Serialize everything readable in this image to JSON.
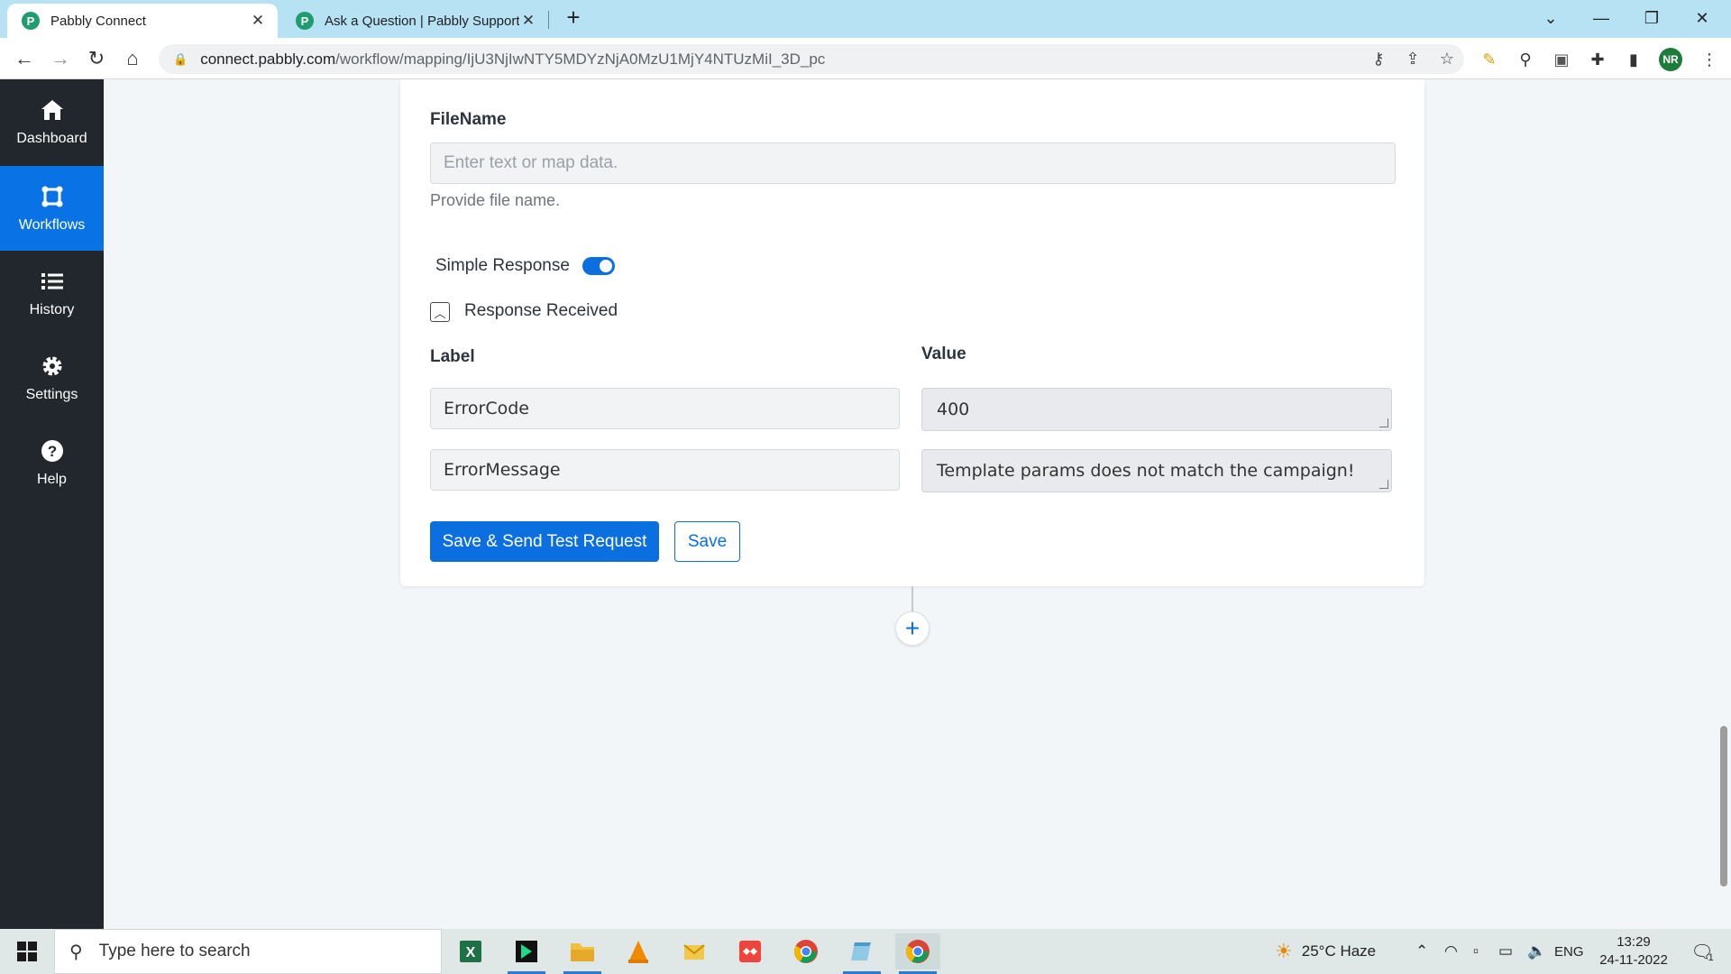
{
  "browser": {
    "tabs": [
      {
        "title": "Pabbly Connect",
        "active": true
      },
      {
        "title": "Ask a Question | Pabbly Support",
        "active": false
      }
    ],
    "url_host": "connect.pabbly.com",
    "url_path": "/workflow/mapping/IjU3NjIwNTY5MDYzNjA0MzU1MjY4NTUzMiI_3D_pc",
    "profile_initials": "NR"
  },
  "sidebar": {
    "items": [
      {
        "label": "Dashboard",
        "icon": "home-icon",
        "active": false
      },
      {
        "label": "Workflows",
        "icon": "workflow-icon",
        "active": true
      },
      {
        "label": "History",
        "icon": "list-icon",
        "active": false
      },
      {
        "label": "Settings",
        "icon": "gear-icon",
        "active": false
      },
      {
        "label": "Help",
        "icon": "question-icon",
        "active": false
      }
    ]
  },
  "form": {
    "filename_label": "FileName",
    "filename_placeholder": "Enter text or map data.",
    "filename_help": "Provide file name.",
    "simple_response_label": "Simple Response",
    "simple_response_on": true,
    "response_received_label": "Response Received",
    "label_col": "Label",
    "value_col": "Value",
    "rows": [
      {
        "label": "ErrorCode",
        "value": "400"
      },
      {
        "label": "ErrorMessage",
        "value": "Template params does not match the campaign!"
      }
    ],
    "save_send_button": "Save & Send Test Request",
    "save_button": "Save"
  },
  "taskbar": {
    "search_placeholder": "Type here to search",
    "weather": "25°C  Haze",
    "language": "ENG",
    "time": "13:29",
    "date": "24-11-2022",
    "notification_count": "1"
  },
  "colors": {
    "accent": "#0b6fe0",
    "sidebar_bg": "#22262d",
    "tabstrip_bg": "#b7e2f4"
  }
}
